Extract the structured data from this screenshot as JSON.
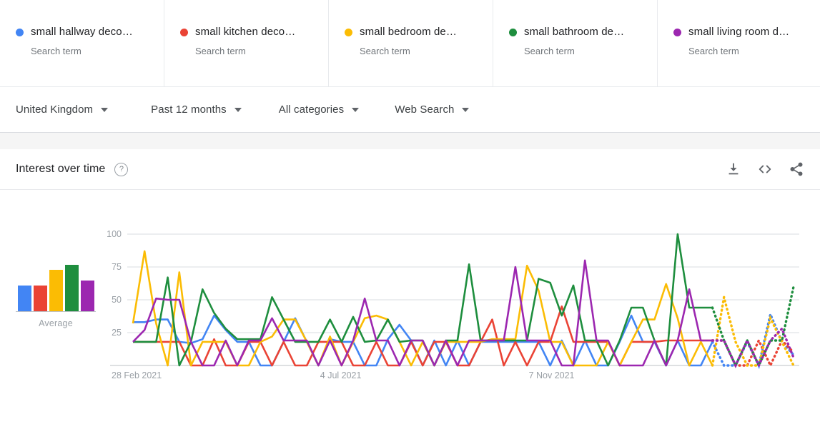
{
  "terms": [
    {
      "title": "small hallway deco…",
      "subtitle": "Search term",
      "color": "#4285F4",
      "dot": "series-dot-icon"
    },
    {
      "title": "small kitchen deco…",
      "subtitle": "Search term",
      "color": "#EA4335",
      "dot": "series-dot-icon"
    },
    {
      "title": "small bedroom de…",
      "subtitle": "Search term",
      "color": "#FBBC04",
      "dot": "series-dot-icon"
    },
    {
      "title": "small bathroom de…",
      "subtitle": "Search term",
      "color": "#1E8E3E",
      "dot": "series-dot-icon"
    },
    {
      "title": "small living room d…",
      "subtitle": "Search term",
      "color": "#9C27B0",
      "dot": "series-dot-icon"
    }
  ],
  "filters": [
    {
      "label": "United Kingdom"
    },
    {
      "label": "Past 12 months"
    },
    {
      "label": "All categories"
    },
    {
      "label": "Web Search"
    }
  ],
  "panel": {
    "title": "Interest over time",
    "help": "?",
    "actions": [
      {
        "name": "download-icon",
        "tooltip": "Download"
      },
      {
        "name": "embed-code-icon",
        "tooltip": "Embed"
      },
      {
        "name": "share-icon",
        "tooltip": "Share"
      }
    ]
  },
  "average": {
    "label": "Average",
    "values": [
      20,
      20,
      32,
      36,
      24
    ]
  },
  "chart_data": {
    "type": "line",
    "title": "Interest over time",
    "xlabel": "",
    "ylabel": "",
    "ylim": [
      0,
      100
    ],
    "yticks": [
      0,
      25,
      50,
      75,
      100
    ],
    "ytick_labels": [
      "",
      "25",
      "50",
      "75",
      "100"
    ],
    "grid": true,
    "legend": "top-cards",
    "xtick_labels": [
      "28 Feb 2021",
      "4 Jul 2021",
      "7 Nov 2021"
    ],
    "xtick_positions": [
      0,
      18,
      36
    ],
    "partial_from_index": 50,
    "series": [
      {
        "name": "small hallway deco…",
        "color": "#4285F4",
        "values": [
          33,
          33,
          35,
          35,
          18,
          17,
          20,
          38,
          27,
          18,
          18,
          0,
          0,
          18,
          36,
          18,
          0,
          20,
          18,
          18,
          0,
          0,
          20,
          31,
          19,
          0,
          19,
          0,
          19,
          0,
          18,
          18,
          18,
          18,
          18,
          18,
          0,
          19,
          0,
          19,
          0,
          0,
          18,
          38,
          18,
          18,
          0,
          19,
          0,
          0,
          18,
          0,
          0,
          18,
          0,
          39,
          18,
          8
        ]
      },
      {
        "name": "small kitchen deco…",
        "color": "#EA4335",
        "values": [
          18,
          18,
          18,
          18,
          18,
          0,
          0,
          20,
          0,
          0,
          18,
          18,
          0,
          18,
          0,
          0,
          18,
          18,
          18,
          0,
          0,
          18,
          0,
          0,
          18,
          0,
          18,
          18,
          0,
          0,
          18,
          35,
          0,
          18,
          0,
          18,
          18,
          45,
          18,
          18,
          18,
          18,
          0,
          18,
          18,
          18,
          19,
          19,
          19,
          19,
          19,
          19,
          0,
          0,
          19,
          0,
          19,
          10,
          0
        ]
      },
      {
        "name": "small bedroom de…",
        "color": "#FBBC04",
        "values": [
          32,
          87,
          32,
          0,
          71,
          0,
          18,
          18,
          18,
          0,
          0,
          18,
          22,
          35,
          35,
          18,
          0,
          22,
          0,
          18,
          36,
          38,
          35,
          18,
          0,
          18,
          0,
          18,
          18,
          18,
          18,
          20,
          20,
          20,
          76,
          57,
          18,
          18,
          0,
          0,
          0,
          18,
          0,
          18,
          35,
          35,
          62,
          36,
          0,
          18,
          0,
          52,
          18,
          0,
          0,
          36,
          18,
          0
        ]
      },
      {
        "name": "small bathroom de…",
        "color": "#1E8E3E",
        "values": [
          18,
          18,
          18,
          67,
          0,
          18,
          58,
          40,
          28,
          20,
          20,
          20,
          52,
          35,
          18,
          18,
          18,
          35,
          18,
          37,
          18,
          19,
          35,
          18,
          19,
          19,
          0,
          19,
          19,
          77,
          19,
          19,
          19,
          19,
          19,
          66,
          63,
          38,
          61,
          19,
          19,
          0,
          19,
          44,
          44,
          19,
          0,
          100,
          44,
          44,
          44,
          19,
          0,
          19,
          0,
          19,
          19,
          60
        ]
      },
      {
        "name": "small living room d…",
        "color": "#9C27B0",
        "values": [
          18,
          27,
          51,
          50,
          50,
          18,
          0,
          0,
          19,
          0,
          19,
          19,
          36,
          19,
          19,
          19,
          0,
          19,
          0,
          19,
          51,
          19,
          19,
          0,
          19,
          19,
          0,
          19,
          0,
          19,
          19,
          19,
          19,
          75,
          19,
          19,
          19,
          0,
          0,
          80,
          19,
          19,
          0,
          0,
          0,
          19,
          0,
          19,
          58,
          19,
          19,
          19,
          0,
          19,
          0,
          19,
          28,
          6
        ]
      }
    ]
  }
}
